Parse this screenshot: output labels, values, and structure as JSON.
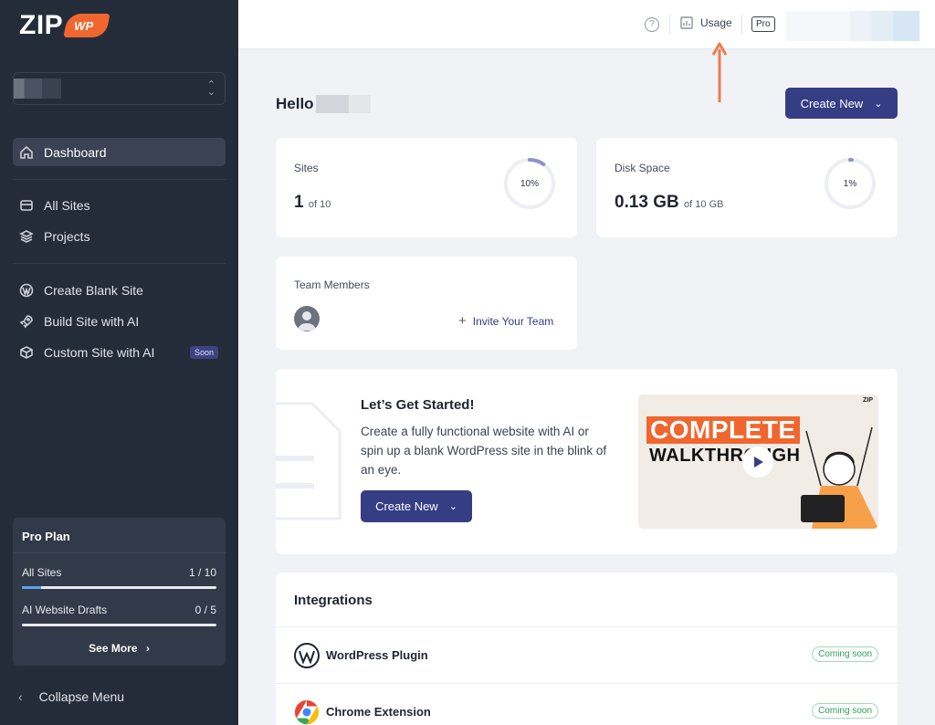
{
  "brand": {
    "logo_main": "ZIP",
    "logo_badge": "WP"
  },
  "sidebar": {
    "nav_top": [
      {
        "label": "Dashboard",
        "icon": "home-icon"
      }
    ],
    "nav_sites": [
      {
        "label": "All Sites",
        "icon": "database-icon"
      },
      {
        "label": "Projects",
        "icon": "layers-icon"
      }
    ],
    "nav_create": [
      {
        "label": "Create Blank Site",
        "icon": "wordpress-icon"
      },
      {
        "label": "Build Site with AI",
        "icon": "rocket-icon"
      },
      {
        "label": "Custom Site with AI",
        "icon": "cube-icon",
        "badge": "Soon"
      }
    ],
    "plan": {
      "title": "Pro Plan",
      "rows": [
        {
          "label": "All Sites",
          "value": "1 / 10",
          "fraction": 0.1
        },
        {
          "label": "AI Website Drafts",
          "value": "0 / 5",
          "fraction": 0
        }
      ],
      "see_more": "See More"
    },
    "collapse_label": "Collapse Menu"
  },
  "topbar": {
    "help": "?",
    "usage_label": "Usage",
    "plan_badge": "Pro"
  },
  "main": {
    "greeting": "Hello",
    "create_new_label": "Create New",
    "sites_card": {
      "label": "Sites",
      "value": "1",
      "of": "of 10",
      "percent_label": "10%",
      "percent": 10
    },
    "disk_card": {
      "label": "Disk Space",
      "value": "0.13 GB",
      "of": "of 10 GB",
      "percent_label": "1%",
      "percent": 1
    },
    "team_card": {
      "label": "Team Members",
      "invite_label": "Invite Your Team"
    },
    "get_started": {
      "title": "Let’s Get Started!",
      "description": "Create a fully functional website with AI or spin up a blank WordPress site in the blink of an eye.",
      "button": "Create New",
      "video_line1": "COMPLETE",
      "video_line2": "WALKTHROUGH",
      "video_logo": "ZIP"
    },
    "integrations": {
      "title": "Integrations",
      "items": [
        {
          "name": "WordPress Plugin",
          "status": "Coming soon"
        },
        {
          "name": "Chrome Extension",
          "status": "Coming soon"
        }
      ]
    }
  },
  "colors": {
    "sidebar_bg": "#252c39",
    "primary": "#353d84",
    "accent_orange": "#f0662e",
    "success": "#2f9e5b"
  }
}
